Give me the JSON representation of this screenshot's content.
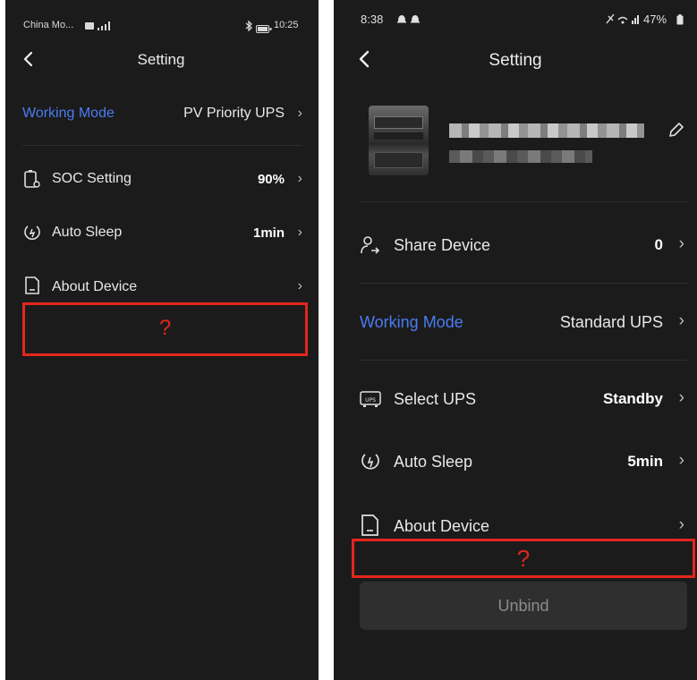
{
  "left": {
    "status": {
      "carrier": "China Mo...",
      "time": "10:25"
    },
    "header": {
      "title": "Setting"
    },
    "working_mode": {
      "label": "Working Mode",
      "value": "PV Priority UPS"
    },
    "items": [
      {
        "label": "SOC Setting",
        "value": "90%",
        "icon": "battery-icon"
      },
      {
        "label": "Auto Sleep",
        "value": "1min",
        "icon": "sleep-timer-icon"
      },
      {
        "label": "About Device",
        "value": "",
        "icon": "device-info-icon"
      }
    ],
    "highlight": {
      "mark": "?"
    }
  },
  "right": {
    "status": {
      "time": "8:38",
      "battery": "47%"
    },
    "header": {
      "title": "Setting"
    },
    "share": {
      "label": "Share Device",
      "value": "0"
    },
    "working_mode": {
      "label": "Working Mode",
      "value": "Standard UPS"
    },
    "items": [
      {
        "label": "Select UPS",
        "value": "Standby",
        "icon": "ups-icon"
      },
      {
        "label": "Auto Sleep",
        "value": "5min",
        "icon": "sleep-timer-icon"
      },
      {
        "label": "About Device",
        "value": "",
        "icon": "device-info-icon"
      }
    ],
    "highlight": {
      "mark": "?"
    },
    "unbind_label": "Unbind"
  },
  "colors": {
    "accent": "#4a7cf2",
    "highlight": "#e3261d",
    "background": "#1b1b1b"
  }
}
